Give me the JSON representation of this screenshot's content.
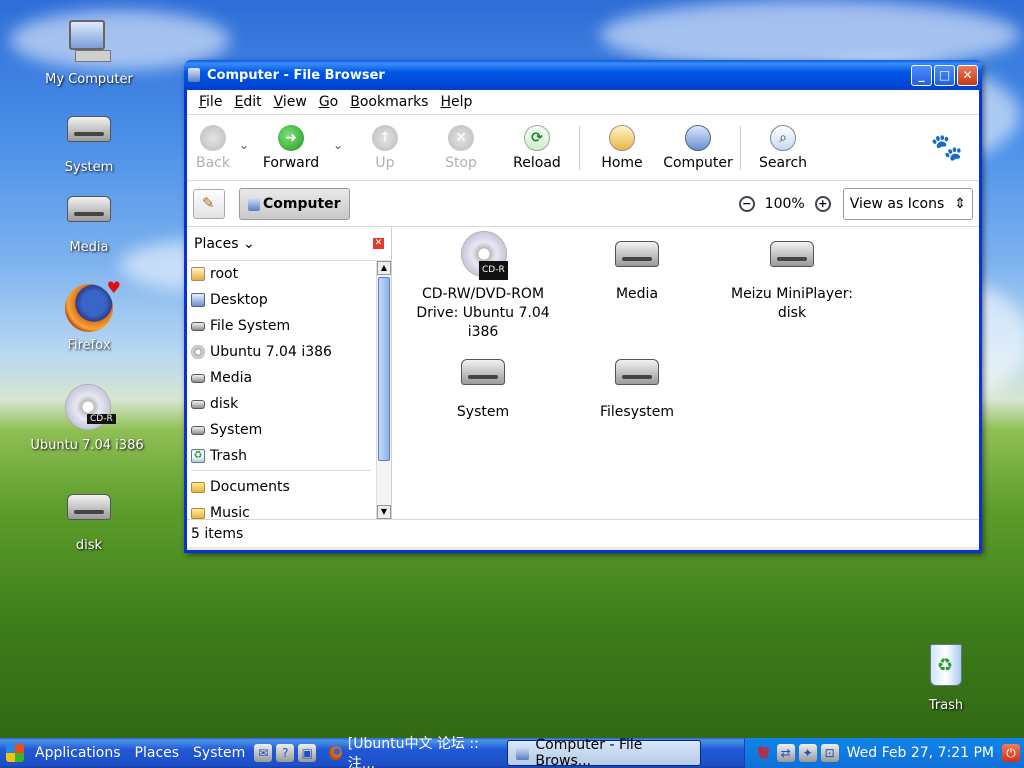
{
  "desktop": {
    "icons": [
      {
        "label": "My Computer",
        "icon": "computer-icon"
      },
      {
        "label": "System",
        "icon": "drive-icon"
      },
      {
        "label": "Media",
        "icon": "drive-icon"
      },
      {
        "label": "Firefox",
        "icon": "firefox-icon"
      },
      {
        "label": "Ubuntu 7.04 i386",
        "icon": "cdrom-icon"
      },
      {
        "label": "disk",
        "icon": "drive-icon"
      },
      {
        "label": "Trash",
        "icon": "trash-icon"
      }
    ],
    "cd_badge": "CD-R"
  },
  "window": {
    "title": "Computer - File Browser",
    "controls": {
      "minimize": "_",
      "maximize": "□",
      "close": "✕"
    },
    "menu": [
      {
        "label": "File",
        "mnemonic": "F",
        "rest": "ile"
      },
      {
        "label": "Edit",
        "mnemonic": "E",
        "rest": "dit"
      },
      {
        "label": "View",
        "mnemonic": "V",
        "rest": "iew"
      },
      {
        "label": "Go",
        "mnemonic": "G",
        "rest": "o"
      },
      {
        "label": "Bookmarks",
        "mnemonic": "B",
        "rest": "ookmarks"
      },
      {
        "label": "Help",
        "mnemonic": "H",
        "rest": "elp"
      }
    ],
    "toolbar": {
      "back": "Back",
      "forward": "Forward",
      "up": "Up",
      "stop": "Stop",
      "reload": "Reload",
      "home": "Home",
      "computer": "Computer",
      "search": "Search"
    },
    "location": {
      "crumb": "Computer",
      "zoom": "100%",
      "view_mode": "View as Icons"
    },
    "sidebar": {
      "title": "Places",
      "items": [
        {
          "label": "root",
          "icon": "home-folder-icon"
        },
        {
          "label": "Desktop",
          "icon": "desktop-icon"
        },
        {
          "label": "File System",
          "icon": "drive-icon"
        },
        {
          "label": "Ubuntu 7.04 i386",
          "icon": "cdrom-icon"
        },
        {
          "label": "Media",
          "icon": "drive-icon"
        },
        {
          "label": "disk",
          "icon": "drive-icon"
        },
        {
          "label": "System",
          "icon": "drive-icon"
        },
        {
          "label": "Trash",
          "icon": "trash-icon"
        }
      ],
      "bookmarks": [
        {
          "label": "Documents",
          "icon": "folder-icon"
        },
        {
          "label": "Music",
          "icon": "folder-icon"
        }
      ]
    },
    "files": [
      {
        "label": "CD-RW/DVD-ROM Drive: Ubuntu 7.04 i386",
        "icon": "cdrom-icon"
      },
      {
        "label": "Media",
        "icon": "drive-icon"
      },
      {
        "label": "Meizu MiniPlayer: disk",
        "icon": "removable-drive-icon"
      },
      {
        "label": "System",
        "icon": "drive-icon"
      },
      {
        "label": "Filesystem",
        "icon": "drive-icon"
      }
    ],
    "status": "5 items"
  },
  "taskbar": {
    "menus": [
      "Applications",
      "Places",
      "System"
    ],
    "tasks": [
      {
        "label": "[Ubuntu中文 论坛 :: 注...",
        "active": false
      },
      {
        "label": "Computer - File Brows...",
        "active": true
      }
    ],
    "tray_ime": "智",
    "clock": "Wed Feb 27,  7:21 PM"
  }
}
